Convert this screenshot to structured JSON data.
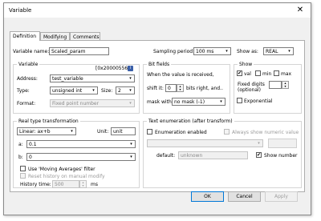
{
  "window": {
    "title": "Variable",
    "close_glyph": "✕"
  },
  "tabs": [
    {
      "label": "Definition"
    },
    {
      "label": "Modifying"
    },
    {
      "label": "Comments"
    }
  ],
  "header": {
    "variable_name_label": "Variable name:",
    "variable_name_value": "Scaled_param",
    "sampling_period_label": "Sampling period:",
    "sampling_period_value": "100 ms",
    "show_as_label": "Show as:",
    "show_as_value": "REAL"
  },
  "variable": {
    "title": "Variable",
    "address_hex": "[0x20000556]",
    "address_label": "Address:",
    "address_value": "test_variable",
    "type_label": "Type:",
    "type_value": "unsigned int",
    "size_label": "Size:",
    "size_value": "2",
    "format_label": "Format:",
    "format_value": "Fixed point number"
  },
  "bitfields": {
    "title": "Bit fields",
    "description": "When the value is received,",
    "shift_label": "shift it:",
    "shift_value": "0",
    "shift_suffix": "bits right, and..",
    "mask_label": "mask with:",
    "mask_value": "no mask (-1)"
  },
  "show": {
    "title": "Show",
    "val_label": "val",
    "min_label": "min",
    "max_label": "max",
    "val_checked": true,
    "min_checked": false,
    "max_checked": false,
    "fixed_digits_label": "Fixed digits",
    "fixed_digits_sub": "(optional)",
    "exponential_label": "Exponential"
  },
  "transform": {
    "title": "Real type transformation",
    "type_value": "Linear: ax+b",
    "unit_label": "Unit:",
    "unit_value": "unit",
    "a_label": "a:",
    "a_value": "0.1",
    "b_label": "b:",
    "b_value": "0",
    "moving_avg_label": "Use 'Moving Averages' filter",
    "reset_history_label": "Reset history on manual modify",
    "history_time_label": "History time:",
    "history_time_value": "500",
    "history_time_unit": "ms"
  },
  "enumeration": {
    "title": "Text enumeration (after transform)",
    "enabled_label": "Enumeration enabled",
    "always_show_label": "Always show numeric value",
    "default_label": "default:",
    "default_value": "unknown",
    "show_number_label": "Show number"
  },
  "footer": {
    "ok_label": "OK",
    "cancel_label": "Cancel",
    "apply_label": "Apply"
  },
  "icons": {
    "info": "i",
    "dropdown": "▾",
    "spin_up": "▴",
    "spin_down": "▾",
    "check": "✔"
  }
}
